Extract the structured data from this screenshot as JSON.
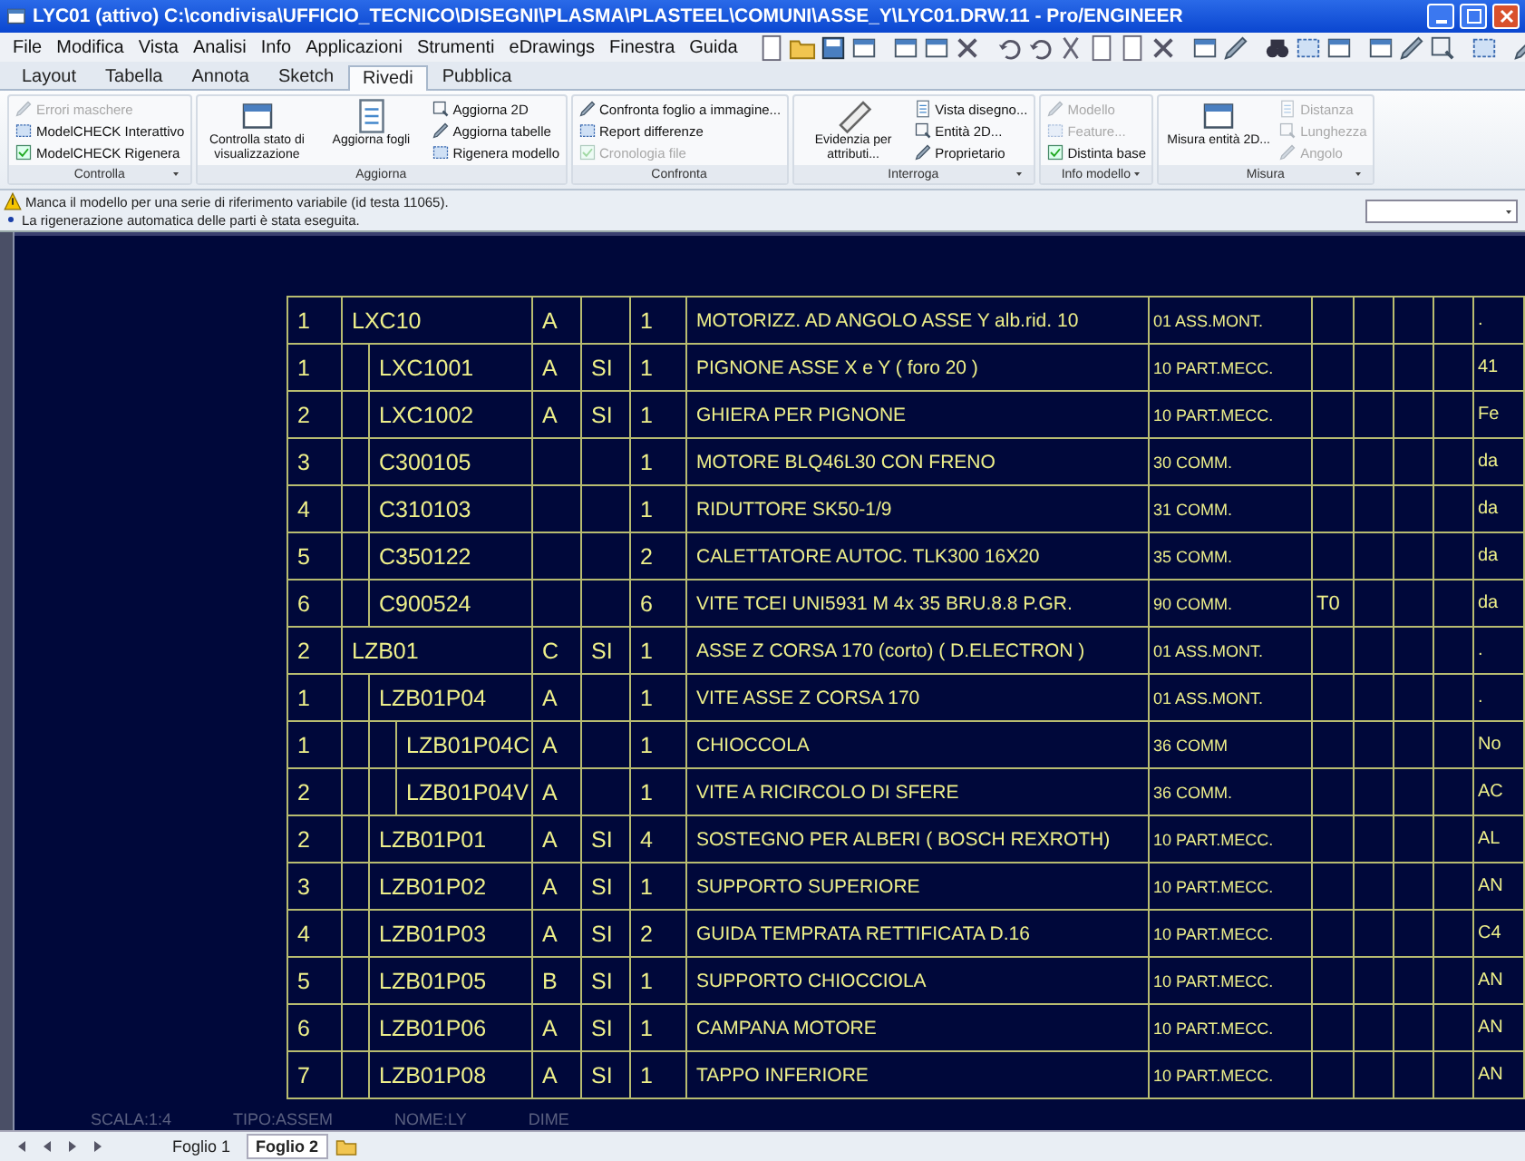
{
  "window": {
    "title": "LYC01 (attivo) C:\\condivisa\\UFFICIO_TECNICO\\DISEGNI\\PLASMA\\PLASTEEL\\COMUNI\\ASSE_Y\\LYC01.DRW.11 - Pro/ENGINEER"
  },
  "menu": [
    "File",
    "Modifica",
    "Vista",
    "Analisi",
    "Info",
    "Applicazioni",
    "Strumenti",
    "eDrawings",
    "Finestra",
    "Guida"
  ],
  "tabs": [
    {
      "label": "Layout",
      "selected": false
    },
    {
      "label": "Tabella",
      "selected": false
    },
    {
      "label": "Annota",
      "selected": false
    },
    {
      "label": "Sketch",
      "selected": false
    },
    {
      "label": "Rivedi",
      "selected": true
    },
    {
      "label": "Pubblica",
      "selected": false
    }
  ],
  "ribbon": {
    "groups": [
      {
        "label": "Controlla",
        "menu": true,
        "items": [
          {
            "kind": "small",
            "label": "Errori maschere",
            "disabled": true
          },
          {
            "kind": "small",
            "label": "ModelCHECK Interattivo",
            "disabled": false
          },
          {
            "kind": "small",
            "label": "ModelCHECK Rigenera",
            "disabled": false
          }
        ]
      },
      {
        "label": "Aggiorna",
        "menu": false,
        "items": [
          {
            "kind": "large",
            "label": "Controlla stato di visualizzazione",
            "disabled": false
          },
          {
            "kind": "large",
            "label": "Aggiorna fogli",
            "disabled": false
          },
          {
            "kind": "small",
            "label": "Aggiorna 2D",
            "disabled": false
          },
          {
            "kind": "small",
            "label": "Aggiorna tabelle",
            "disabled": false
          },
          {
            "kind": "small",
            "label": "Rigenera modello",
            "disabled": false
          }
        ]
      },
      {
        "label": "Confronta",
        "menu": false,
        "items": [
          {
            "kind": "small",
            "label": "Confronta foglio a immagine...",
            "disabled": false
          },
          {
            "kind": "small",
            "label": "Report differenze",
            "disabled": false
          },
          {
            "kind": "small",
            "label": "Cronologia file",
            "disabled": true
          }
        ]
      },
      {
        "label": "Interroga",
        "menu": true,
        "items": [
          {
            "kind": "large",
            "label": "Evidenzia per attributi...",
            "disabled": false
          },
          {
            "kind": "small",
            "label": "Vista disegno...",
            "disabled": false
          },
          {
            "kind": "small",
            "label": "Entità 2D...",
            "disabled": false
          },
          {
            "kind": "small",
            "label": "Proprietario",
            "disabled": false
          }
        ]
      },
      {
        "label": "Info modello",
        "menu": true,
        "items": [
          {
            "kind": "small",
            "label": "Modello",
            "disabled": true
          },
          {
            "kind": "small",
            "label": "Feature...",
            "disabled": true
          },
          {
            "kind": "small",
            "label": "Distinta base",
            "disabled": false
          }
        ]
      },
      {
        "label": "Misura",
        "menu": true,
        "items": [
          {
            "kind": "large",
            "label": "Misura entità 2D...",
            "disabled": false
          },
          {
            "kind": "small",
            "label": "Distanza",
            "disabled": true
          },
          {
            "kind": "small",
            "label": "Lunghezza",
            "disabled": true
          },
          {
            "kind": "small",
            "label": "Angolo",
            "disabled": true
          }
        ]
      }
    ]
  },
  "messages": [
    {
      "kind": "warning",
      "text": "Manca il modello per una serie di riferimento variabile (id testa 11065)."
    },
    {
      "kind": "info",
      "text": "La rigenerazione automatica delle parti è stata eseguita."
    }
  ],
  "table": {
    "rows": [
      {
        "index": "1",
        "name": "LXC10",
        "rev": "A",
        "qty": "1",
        "description": "MOTORIZZ. AD ANGOLO ASSE Y  alb.rid. 10",
        "type": "01 ASS.MONT.",
        "column_13": ".",
        "children": [
          {
            "index": "1",
            "name": "LXC1001",
            "rev": "A",
            "flag": "SI",
            "qty": "1",
            "description": "PIGNONE ASSE X e Y ( foro 20 )",
            "type": "10 PART.MECC.",
            "column_13": "41"
          },
          {
            "index": "2",
            "name": "LXC1002",
            "rev": "A",
            "flag": "SI",
            "qty": "1",
            "description": "GHIERA PER PIGNONE",
            "type": "10 PART.MECC.",
            "column_13": "Fe"
          },
          {
            "index": "3",
            "name": "C300105",
            "qty": "1",
            "description": "MOTORE BLQ46L30 CON FRENO",
            "type": "30 COMM.",
            "column_13": "da"
          },
          {
            "index": "4",
            "name": "C310103",
            "qty": "1",
            "description": "RIDUTTORE SK50-1/9",
            "type": "31 COMM.",
            "column_13": "da"
          },
          {
            "index": "5",
            "name": "C350122",
            "qty": "2",
            "description": "CALETTATORE AUTOC. TLK300 16X20",
            "type": "35 COMM.",
            "column_13": "da"
          },
          {
            "index": "6",
            "name": "C900524",
            "qty": "6",
            "description": "VITE TCEI UNI5931 M 4x 35 BRU.8.8 P.GR.",
            "type": "90 COMM.",
            "column_8": "T0",
            "column_13": "da"
          }
        ]
      },
      {
        "index": "2",
        "name": "LZB01",
        "rev": "C",
        "flag": "SI",
        "qty": "1",
        "description": "ASSE Z CORSA 170 (corto) ( D.ELECTRON )",
        "type": "01 ASS.MONT.",
        "column_13": ".",
        "children": [
          {
            "index": "1",
            "name": "LZB01P04",
            "rev": "A",
            "qty": "1",
            "description": "VITE ASSE Z    CORSA 170",
            "type": "01 ASS.MONT.",
            "column_13": ".",
            "children": [
              {
                "index": "1",
                "name": "LZB01P04C",
                "rev": "A",
                "qty": "1",
                "description": "CHIOCCOLA",
                "type": "36 COMM",
                "column_13": "No"
              },
              {
                "index": "2",
                "name": "LZB01P04V",
                "rev": "A",
                "qty": "1",
                "description": "VITE A RICIRCOLO DI SFERE",
                "type": "36 COMM.",
                "column_13": "AC"
              }
            ]
          },
          {
            "index": "2",
            "name": "LZB01P01",
            "rev": "A",
            "flag": "SI",
            "qty": "4",
            "description": "SOSTEGNO PER ALBERI ( BOSCH REXROTH)",
            "type": "10 PART.MECC.",
            "column_13": "AL"
          },
          {
            "index": "3",
            "name": "LZB01P02",
            "rev": "A",
            "flag": "SI",
            "qty": "1",
            "description": "SUPPORTO SUPERIORE",
            "type": "10 PART.MECC.",
            "column_13": "AN"
          },
          {
            "index": "4",
            "name": "LZB01P03",
            "rev": "A",
            "flag": "SI",
            "qty": "2",
            "description": "GUIDA TEMPRATA RETTIFICATA D.16",
            "type": "10 PART.MECC.",
            "column_13": "C4"
          },
          {
            "index": "5",
            "name": "LZB01P05",
            "rev": "B",
            "flag": "SI",
            "qty": "1",
            "description": "SUPPORTO CHIOCCIOLA",
            "type": "10 PART.MECC.",
            "column_13": "AN"
          },
          {
            "index": "6",
            "name": "LZB01P06",
            "rev": "A",
            "flag": "SI",
            "qty": "1",
            "description": "CAMPANA MOTORE",
            "type": "10 PART.MECC.",
            "column_13": "AN"
          },
          {
            "index": "7",
            "name": "LZB01P08",
            "rev": "A",
            "flag": "SI",
            "qty": "1",
            "description": "TAPPO INFERIORE",
            "type": "10 PART.MECC.",
            "column_13": "AN"
          }
        ]
      }
    ]
  },
  "title_block": [
    "SCALA:1:4",
    "TIPO:ASSEM",
    "NOME:LY",
    "DIME"
  ],
  "sheets": [
    {
      "label": "Foglio 1",
      "selected": false
    },
    {
      "label": "Foglio 2",
      "selected": true
    }
  ]
}
